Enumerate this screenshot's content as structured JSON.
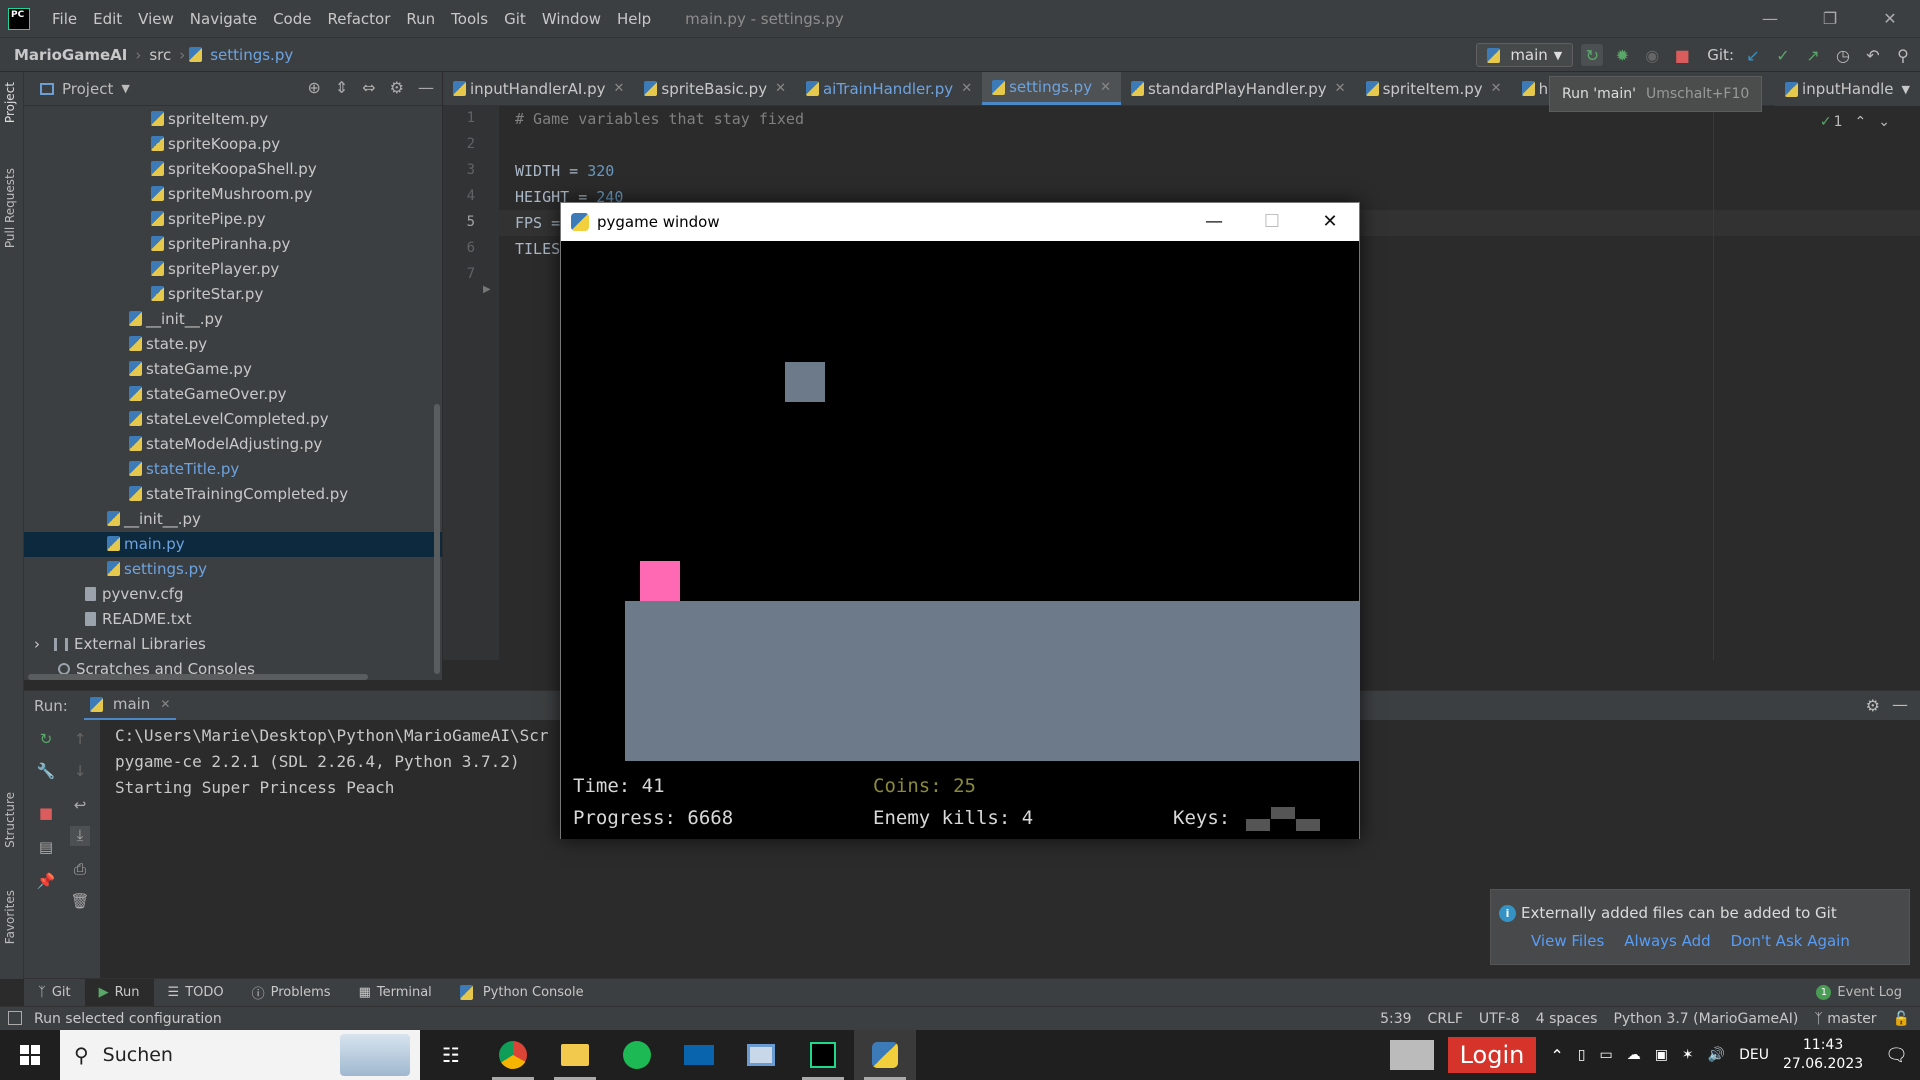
{
  "menubar": {
    "items": [
      "File",
      "Edit",
      "View",
      "Navigate",
      "Code",
      "Refactor",
      "Run",
      "Tools",
      "Git",
      "Window",
      "Help"
    ],
    "window_title": "main.py - settings.py"
  },
  "navbar": {
    "project": "MarioGameAI",
    "folder": "src",
    "file": "settings.py",
    "run_config": "main",
    "git_label": "Git:"
  },
  "tooltip": {
    "text": "Run 'main'",
    "shortcut": "Umschalt+F10"
  },
  "left_strip": {
    "project": "Project",
    "pull_requests": "Pull Requests",
    "structure": "Structure",
    "favorites": "Favorites"
  },
  "project_panel": {
    "title": "Project",
    "tree": [
      "spriteItem.py",
      "spriteKoopa.py",
      "spriteKoopaShell.py",
      "spriteMushroom.py",
      "spritePipe.py",
      "spritePiranha.py",
      "spritePlayer.py",
      "spriteStar.py",
      "__init__.py",
      "state.py",
      "stateGame.py",
      "stateGameOver.py",
      "stateLevelCompleted.py",
      "stateModelAdjusting.py",
      "stateTitle.py",
      "stateTrainingCompleted.py",
      "__init__.py",
      "main.py",
      "settings.py",
      "pyvenv.cfg",
      "README.txt",
      "External Libraries",
      "Scratches and Consoles"
    ]
  },
  "editor": {
    "tabs": [
      "inputHandlerAI.py",
      "spriteBasic.py",
      "aiTrainHandler.py",
      "settings.py",
      "standardPlayHandler.py",
      "spriteItem.py",
      "helperSp",
      "inputHandle"
    ],
    "active_tab": "settings.py",
    "line_numbers": [
      "1",
      "2",
      "3",
      "4",
      "5",
      "6",
      "7"
    ],
    "code": {
      "comment": "# Game variables that stay fixed",
      "width_key": "WIDTH = ",
      "width_val": "320",
      "height_key": "HEIGHT = ",
      "height_val": "240",
      "fps_key": "FPS =",
      "tiles_key": "TILES"
    },
    "inspection_count": "1"
  },
  "run_panel": {
    "label": "Run:",
    "tab": "main",
    "lines": [
      "C:\\Users\\Marie\\Desktop\\Python\\MarioGameAI\\Scr",
      "pygame-ce 2.2.1 (SDL 2.26.4, Python 3.7.2)",
      "Starting Super Princess Peach"
    ]
  },
  "notification": {
    "message": "Externally added files can be added to Git",
    "links": [
      "View Files",
      "Always Add",
      "Don't Ask Again"
    ]
  },
  "tool_tabs": [
    "Git",
    "Run",
    "TODO",
    "Problems",
    "Terminal",
    "Python Console"
  ],
  "event_log": {
    "count": "1",
    "label": "Event Log"
  },
  "statusbar": {
    "message": "Run selected configuration",
    "position": "5:39",
    "line_sep": "CRLF",
    "encoding": "UTF-8",
    "indent": "4 spaces",
    "interpreter": "Python 3.7 (MarioGameAI)",
    "branch": "master"
  },
  "pygame": {
    "title": "pygame window",
    "hud": {
      "time": "Time: 41",
      "coins": "Coins: 25",
      "progress": "Progress: 6668",
      "enemy_kills": "Enemy kills: 4",
      "keys": "Keys:"
    },
    "colors": {
      "player": "#ff69b4",
      "block": "#6c7a89",
      "ground": "#6c7a89",
      "coins_text": "#8a8a3a",
      "hud_text": "#d8d8d8"
    }
  },
  "taskbar": {
    "search_placeholder": "Suchen",
    "login": "Login",
    "lang": "DEU",
    "time": "11:43",
    "date": "27.06.2023"
  }
}
